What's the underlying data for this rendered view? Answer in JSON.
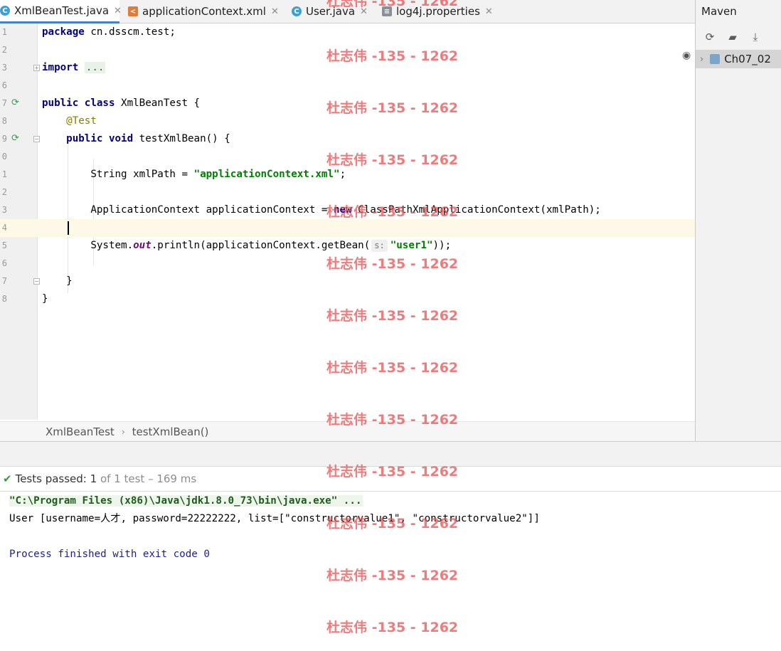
{
  "tabs": [
    {
      "label": "XmlBeanTest.java",
      "icon": "class-icon",
      "active": true
    },
    {
      "label": "applicationContext.xml",
      "icon": "xml-file-icon",
      "active": false
    },
    {
      "label": "User.java",
      "icon": "class-icon",
      "active": false
    },
    {
      "label": "log4j.properties",
      "icon": "properties-file-icon",
      "active": false
    }
  ],
  "maven": {
    "title": "Maven",
    "toolbar": [
      "reload-icon",
      "generate-sources-icon",
      "download-icon"
    ],
    "project": "Ch07_02"
  },
  "editor": {
    "line_numbers": [
      "1",
      "2",
      "3",
      "6",
      "7",
      "8",
      "9",
      "0",
      "1",
      "2",
      "3",
      "4",
      "5",
      "6",
      "7",
      "8"
    ],
    "lines": {
      "l1": {
        "kw": "package",
        "rest": " cn.dsscm.test;"
      },
      "l3": {
        "kw": "import",
        "folded": "..."
      },
      "l7": {
        "kw1": "public",
        "kw2": "class",
        "rest": " XmlBeanTest {"
      },
      "l8": {
        "annotation": "@Test"
      },
      "l9": {
        "kw1": "public",
        "kw2": "void",
        "rest": " testXmlBean() {"
      },
      "l11": {
        "pre": "String xmlPath = ",
        "str": "\"applicationContext.xml\"",
        "post": ";"
      },
      "l13": {
        "pre": "ApplicationContext applicationContext = ",
        "kw": "new",
        "post": " ClassPathXmlApplicationContext(xmlPath);"
      },
      "l15": {
        "pre": "System.",
        "field": "out",
        "mid": ".println(applicationContext.getBean(",
        "hint": "s:",
        "str": "\"user1\"",
        "post": "));"
      },
      "l17": {
        "text": "}"
      },
      "l18": {
        "text": "}"
      }
    }
  },
  "breadcrumb": {
    "class_name": "XmlBeanTest",
    "method_name": "testXmlBean()"
  },
  "tests": {
    "prefix": "Tests passed:",
    "passed": "1",
    "detail": "of 1 test – 169 ms"
  },
  "console": {
    "command": "\"C:\\Program Files (x86)\\Java\\jdk1.8.0_73\\bin\\java.exe\" ...",
    "output": "User [username=人才, password=22222222, list=[\"constructorvalue1\", \"constructorvalue2\"]]",
    "finished": "Process finished with exit code 0"
  },
  "watermark": "杜志伟 -135 - 1262",
  "colors": {
    "accent": "#4083c9",
    "keyword": "#000080",
    "string": "#008000",
    "annotation": "#808000",
    "watermark": "#e85050",
    "pass": "#3a9a3a"
  }
}
